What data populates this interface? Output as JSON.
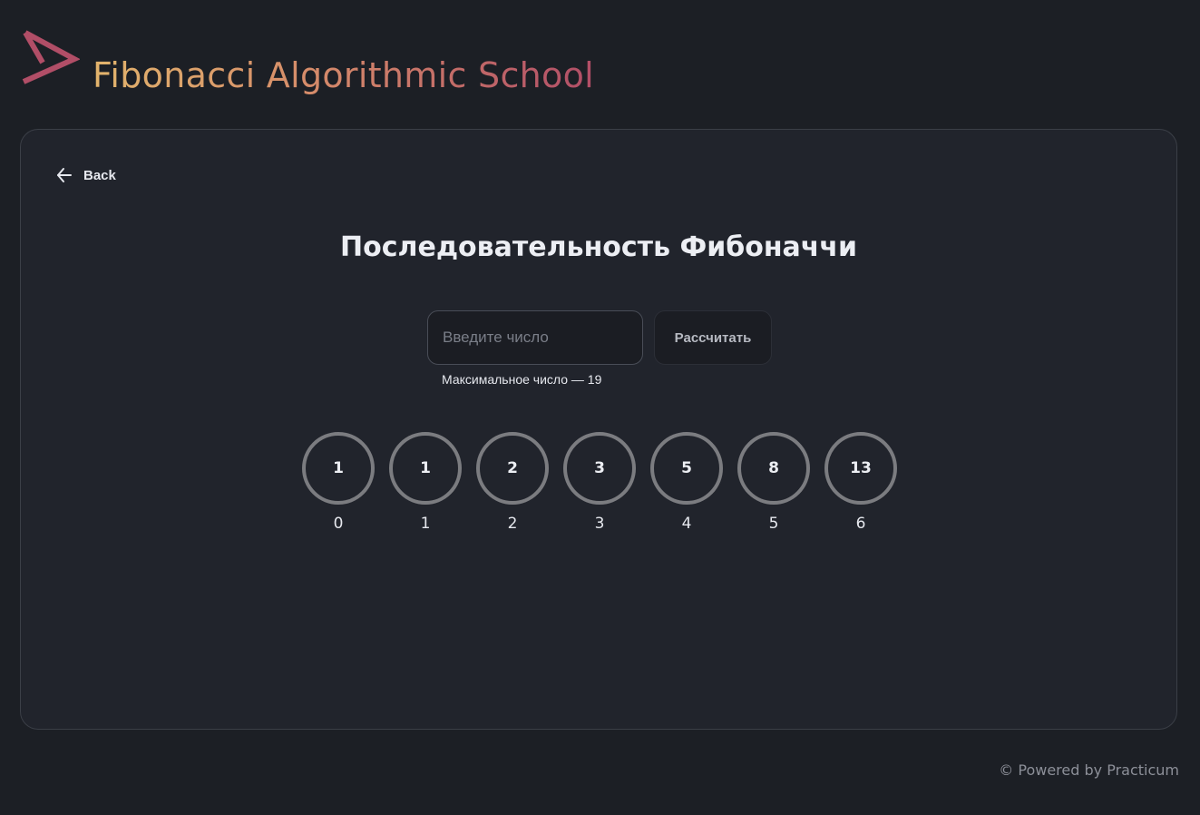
{
  "header": {
    "logo_icon": "triangle-logo-icon",
    "title": "Fibonacci Algorithmic School"
  },
  "back": {
    "icon": "arrow-left-icon",
    "label": "Back"
  },
  "main": {
    "title": "Последовательность Фибоначчи",
    "input_placeholder": "Введите число",
    "input_value": "",
    "hint": "Максимальное число — 19",
    "button_label": "Рассчитать"
  },
  "sequence": [
    {
      "value": "1",
      "index": "0"
    },
    {
      "value": "1",
      "index": "1"
    },
    {
      "value": "2",
      "index": "2"
    },
    {
      "value": "3",
      "index": "3"
    },
    {
      "value": "5",
      "index": "4"
    },
    {
      "value": "8",
      "index": "5"
    },
    {
      "value": "13",
      "index": "6"
    }
  ],
  "footer": {
    "text": "© Powered by Practicum"
  },
  "colors": {
    "background": "#1c1f25",
    "card": "#21242c",
    "accent_start": "#e2b46c",
    "accent_end": "#b14e67",
    "circle_border": "#7b7c80"
  }
}
